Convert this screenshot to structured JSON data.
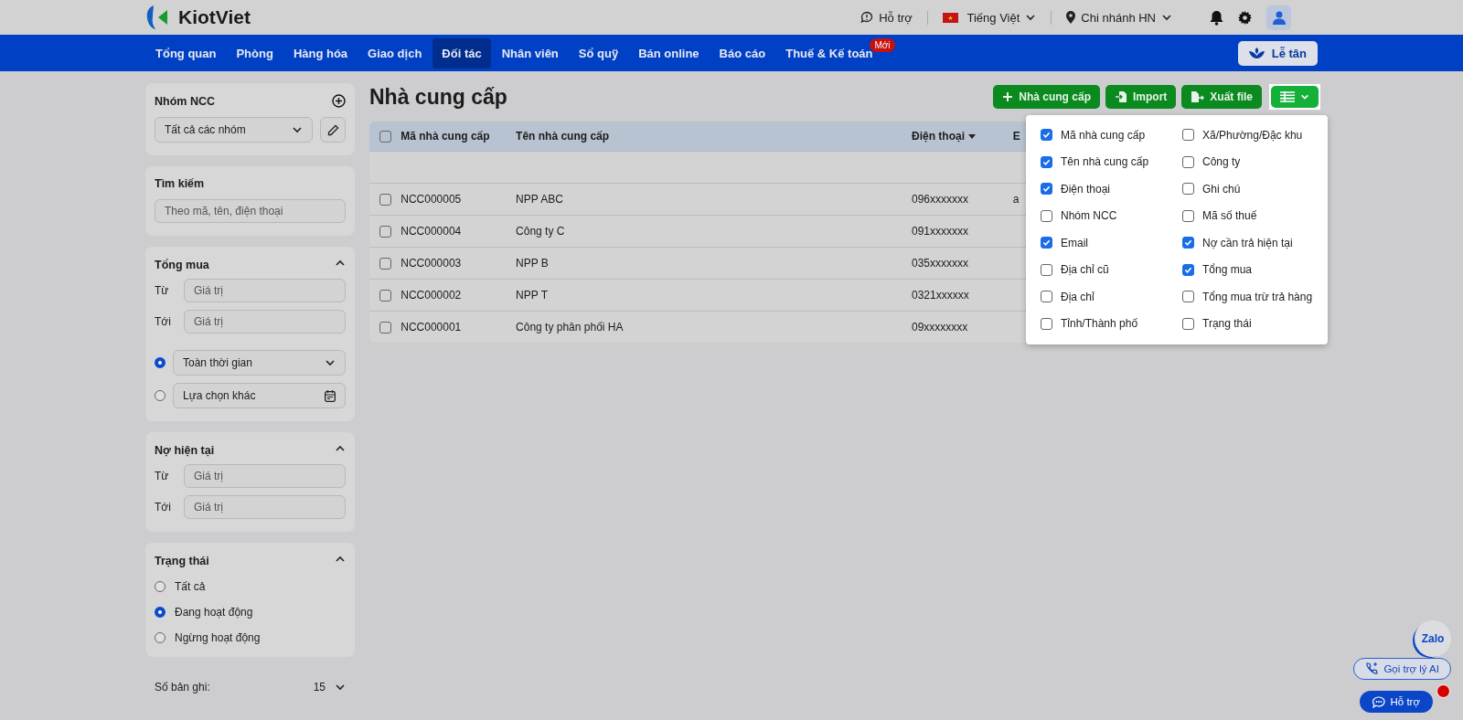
{
  "header": {
    "brand": "KiotViet",
    "support": "Hỗ trợ",
    "language": "Tiếng Việt",
    "branch": "Chi nhánh HN"
  },
  "nav": {
    "items": [
      {
        "label": "Tổng quan",
        "selected": false
      },
      {
        "label": "Phòng",
        "selected": false
      },
      {
        "label": "Hàng hóa",
        "selected": false
      },
      {
        "label": "Giao dịch",
        "selected": false
      },
      {
        "label": "Đối tác",
        "selected": true
      },
      {
        "label": "Nhân viên",
        "selected": false
      },
      {
        "label": "Sổ quỹ",
        "selected": false
      },
      {
        "label": "Bán online",
        "selected": false
      },
      {
        "label": "Báo cáo",
        "selected": false
      },
      {
        "label": "Thuế & Kế toán",
        "selected": false,
        "badge": "Mới"
      }
    ],
    "reception_button": "Lễ tân"
  },
  "sidebar": {
    "group": {
      "title": "Nhóm NCC",
      "value": "Tất cả các nhóm"
    },
    "search": {
      "title": "Tìm kiếm",
      "placeholder": "Theo mã, tên, điện thoại"
    },
    "total_purchase": {
      "title": "Tổng mua",
      "expanded": true,
      "from_label": "Từ",
      "from_placeholder": "Giá trị",
      "to_label": "Tới",
      "to_placeholder": "Giá trị",
      "time_options": [
        {
          "label": "Toàn thời gian",
          "selected": true,
          "kind": "dropdown"
        },
        {
          "label": "Lựa chọn khác",
          "selected": false,
          "kind": "date"
        }
      ]
    },
    "current_debt": {
      "title": "Nợ hiện tại",
      "expanded": true,
      "from_label": "Từ",
      "from_placeholder": "Giá trị",
      "to_label": "Tới",
      "to_placeholder": "Giá trị"
    },
    "status": {
      "title": "Trạng thái",
      "expanded": true,
      "options": [
        {
          "label": "Tất cả",
          "selected": false
        },
        {
          "label": "Đang hoạt động",
          "selected": true
        },
        {
          "label": "Ngừng hoạt động",
          "selected": false
        }
      ]
    },
    "records": {
      "label": "Số bản ghi:",
      "value": "15"
    }
  },
  "page": {
    "title": "Nhà cung cấp",
    "buttons": [
      {
        "label": "Nhà cung cấp",
        "kind": "add"
      },
      {
        "label": "Import",
        "kind": "import"
      },
      {
        "label": "Xuất file",
        "kind": "export"
      }
    ]
  },
  "table": {
    "select_all": false,
    "columns": [
      {
        "label": "Mã nhà cung cấp",
        "sorted": false
      },
      {
        "label": "Tên nhà cung cấp",
        "sorted": false
      },
      {
        "label": "Điện thoại",
        "sorted": true
      },
      {
        "label": "E",
        "sorted": false
      }
    ],
    "rows": [
      {
        "checked": false,
        "cells": [
          "NCC000005",
          "NPP ABC",
          "096xxxxxxx",
          "a"
        ]
      },
      {
        "checked": false,
        "cells": [
          "NCC000004",
          "Công ty C",
          "091xxxxxxx",
          ""
        ]
      },
      {
        "checked": false,
        "cells": [
          "NCC000003",
          "NPP B",
          "035xxxxxxx",
          ""
        ]
      },
      {
        "checked": false,
        "cells": [
          "NCC000002",
          "NPP T",
          "0321xxxxxx",
          ""
        ]
      },
      {
        "checked": false,
        "cells": [
          "NCC000001",
          "Công ty phân phối HA",
          "09xxxxxxxx",
          ""
        ]
      }
    ]
  },
  "column_menu": {
    "items": [
      {
        "label": "Mã nhà cung cấp",
        "checked": true
      },
      {
        "label": "Tên nhà cung cấp",
        "checked": true
      },
      {
        "label": "Điện thoại",
        "checked": true
      },
      {
        "label": "Nhóm NCC",
        "checked": false
      },
      {
        "label": "Email",
        "checked": true
      },
      {
        "label": "Địa chỉ cũ",
        "checked": false
      },
      {
        "label": "Địa chỉ",
        "checked": false
      },
      {
        "label": "Tỉnh/Thành phố",
        "checked": false
      },
      {
        "label": "Xã/Phường/Đặc khu",
        "checked": false
      },
      {
        "label": "Công ty",
        "checked": false
      },
      {
        "label": "Ghi chú",
        "checked": false
      },
      {
        "label": "Mã số thuế",
        "checked": false
      },
      {
        "label": "Nợ cần trả hiện tại",
        "checked": true
      },
      {
        "label": "Tổng mua",
        "checked": true
      },
      {
        "label": "Tổng mua trừ trả hàng",
        "checked": false
      },
      {
        "label": "Trạng thái",
        "checked": false
      }
    ]
  },
  "floating": {
    "zalo": "Zalo",
    "ai_call": "Gọi trợ lý AI",
    "support": "Hỗ trợ"
  }
}
